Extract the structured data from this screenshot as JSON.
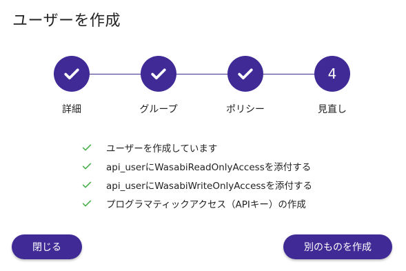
{
  "page": {
    "title": "ユーザーを作成"
  },
  "stepper": {
    "steps": [
      {
        "label": "詳細",
        "state": "done"
      },
      {
        "label": "グループ",
        "state": "done"
      },
      {
        "label": "ポリシー",
        "state": "done"
      },
      {
        "label": "見直し",
        "state": "current",
        "number": "4"
      }
    ]
  },
  "tasks": [
    {
      "text": "ユーザーを作成しています",
      "status": "done"
    },
    {
      "text": "api_userにWasabiReadOnlyAccessを添付する",
      "status": "done"
    },
    {
      "text": "api_userにWasabiWriteOnlyAccessを添付する",
      "status": "done"
    },
    {
      "text": "プログラマティックアクセス（APIキー）の作成",
      "status": "done"
    }
  ],
  "buttons": {
    "close_label": "閉じる",
    "create_another_label": "別のものを作成"
  },
  "colors": {
    "primary": "#3f2a96",
    "check_green": "#4caf50"
  }
}
